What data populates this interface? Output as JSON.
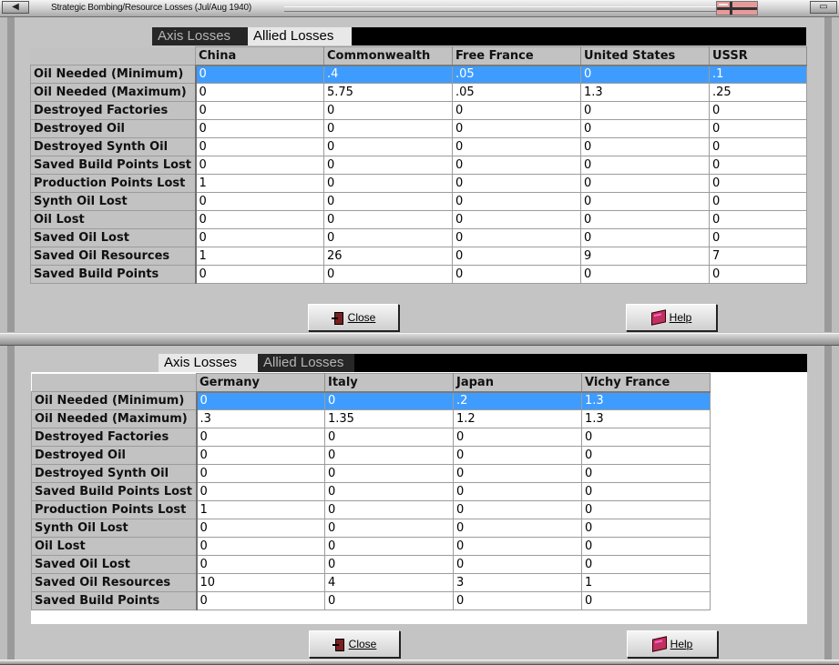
{
  "window": {
    "title": "Strategic Bombing/Resource Losses (Jul/Aug 1940)",
    "menu_button_glyph": "◀",
    "restore_button_glyph": "▭",
    "flag_icon": "flag-icon"
  },
  "tabs": {
    "axis_label": "Axis Losses",
    "allied_label": "Allied Losses"
  },
  "row_labels": [
    "Oil Needed (Minimum)",
    "Oil Needed (Maximum)",
    "Destroyed Factories",
    "Destroyed Oil",
    "Destroyed Synth Oil",
    "Saved Build Points Lost",
    "Production Points Lost",
    "Synth Oil Lost",
    "Oil Lost",
    "Saved Oil Lost",
    "Saved Oil Resources",
    "Saved Build Points"
  ],
  "allied_table": {
    "columns": [
      "China",
      "Commonwealth",
      "Free France",
      "United States",
      "USSR"
    ],
    "rows": [
      [
        "0",
        ".4",
        ".05",
        "0",
        ".1"
      ],
      [
        "0",
        "5.75",
        ".05",
        "1.3",
        ".25"
      ],
      [
        "0",
        "0",
        "0",
        "0",
        "0"
      ],
      [
        "0",
        "0",
        "0",
        "0",
        "0"
      ],
      [
        "0",
        "0",
        "0",
        "0",
        "0"
      ],
      [
        "0",
        "0",
        "0",
        "0",
        "0"
      ],
      [
        "1",
        "0",
        "0",
        "0",
        "0"
      ],
      [
        "0",
        "0",
        "0",
        "0",
        "0"
      ],
      [
        "0",
        "0",
        "0",
        "0",
        "0"
      ],
      [
        "0",
        "0",
        "0",
        "0",
        "0"
      ],
      [
        "1",
        "26",
        "0",
        "9",
        "7"
      ],
      [
        "0",
        "0",
        "0",
        "0",
        "0"
      ]
    ],
    "selected_row": 0
  },
  "axis_table": {
    "columns": [
      "Germany",
      "Italy",
      "Japan",
      "Vichy France"
    ],
    "rows": [
      [
        "0",
        "0",
        ".2",
        "1.3"
      ],
      [
        ".3",
        "1.35",
        "1.2",
        "1.3"
      ],
      [
        "0",
        "0",
        "0",
        "0"
      ],
      [
        "0",
        "0",
        "0",
        "0"
      ],
      [
        "0",
        "0",
        "0",
        "0"
      ],
      [
        "0",
        "0",
        "0",
        "0"
      ],
      [
        "1",
        "0",
        "0",
        "0"
      ],
      [
        "0",
        "0",
        "0",
        "0"
      ],
      [
        "0",
        "0",
        "0",
        "0"
      ],
      [
        "0",
        "0",
        "0",
        "0"
      ],
      [
        "10",
        "4",
        "3",
        "1"
      ],
      [
        "0",
        "0",
        "0",
        "0"
      ]
    ],
    "selected_row": 0
  },
  "buttons": {
    "close_label": "Close",
    "help_label": "Help"
  },
  "colors": {
    "selection": "#3f9cff",
    "header_bg": "#c2c2c2",
    "tab_bg": "#000000"
  }
}
